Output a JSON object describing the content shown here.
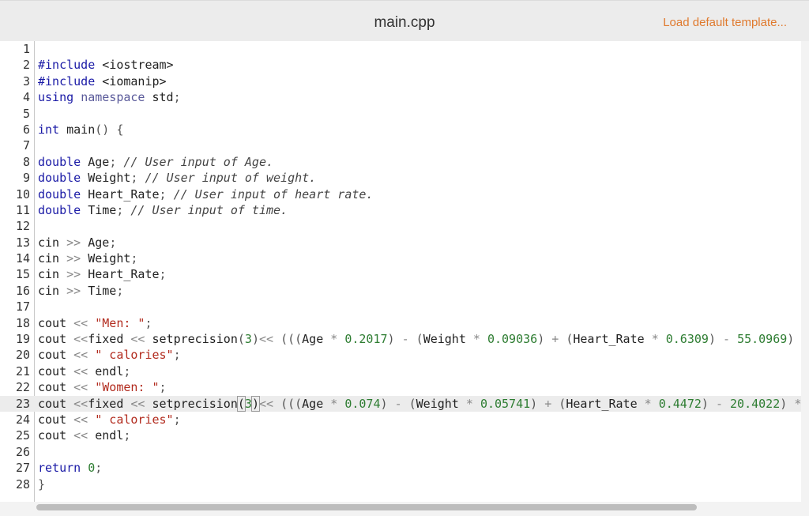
{
  "header": {
    "file_name": "main.cpp",
    "load_template_label": "Load default template..."
  },
  "editor": {
    "active_line": 23,
    "lines": [
      {
        "n": "1",
        "tokens": []
      },
      {
        "n": "2",
        "tokens": [
          [
            "pp",
            "#include "
          ],
          [
            "id",
            "<iostream>"
          ]
        ]
      },
      {
        "n": "3",
        "tokens": [
          [
            "pp",
            "#include "
          ],
          [
            "id",
            "<iomanip>"
          ]
        ]
      },
      {
        "n": "4",
        "tokens": [
          [
            "kw",
            "using "
          ],
          [
            "ns",
            "namespace "
          ],
          [
            "id",
            "std"
          ],
          [
            "pun",
            ";"
          ]
        ]
      },
      {
        "n": "5",
        "tokens": []
      },
      {
        "n": "6",
        "tokens": [
          [
            "kw",
            "int "
          ],
          [
            "id",
            "main"
          ],
          [
            "pun",
            "() {"
          ]
        ]
      },
      {
        "n": "7",
        "tokens": []
      },
      {
        "n": "8",
        "tokens": [
          [
            "kw",
            "double "
          ],
          [
            "id",
            "Age"
          ],
          [
            "pun",
            "; "
          ],
          [
            "cm",
            "// User input of Age."
          ]
        ]
      },
      {
        "n": "9",
        "tokens": [
          [
            "kw",
            "double "
          ],
          [
            "id",
            "Weight"
          ],
          [
            "pun",
            "; "
          ],
          [
            "cm",
            "// User input of weight."
          ]
        ]
      },
      {
        "n": "10",
        "tokens": [
          [
            "kw",
            "double "
          ],
          [
            "id",
            "Heart_Rate"
          ],
          [
            "pun",
            "; "
          ],
          [
            "cm",
            "// User input of heart rate."
          ]
        ]
      },
      {
        "n": "11",
        "tokens": [
          [
            "kw",
            "double "
          ],
          [
            "id",
            "Time"
          ],
          [
            "pun",
            "; "
          ],
          [
            "cm",
            "// User input of time."
          ]
        ]
      },
      {
        "n": "12",
        "tokens": []
      },
      {
        "n": "13",
        "tokens": [
          [
            "id",
            "cin "
          ],
          [
            "op",
            ">> "
          ],
          [
            "id",
            "Age"
          ],
          [
            "pun",
            ";"
          ]
        ]
      },
      {
        "n": "14",
        "tokens": [
          [
            "id",
            "cin "
          ],
          [
            "op",
            ">> "
          ],
          [
            "id",
            "Weight"
          ],
          [
            "pun",
            ";"
          ]
        ]
      },
      {
        "n": "15",
        "tokens": [
          [
            "id",
            "cin "
          ],
          [
            "op",
            ">> "
          ],
          [
            "id",
            "Heart_Rate"
          ],
          [
            "pun",
            ";"
          ]
        ]
      },
      {
        "n": "16",
        "tokens": [
          [
            "id",
            "cin "
          ],
          [
            "op",
            ">> "
          ],
          [
            "id",
            "Time"
          ],
          [
            "pun",
            ";"
          ]
        ]
      },
      {
        "n": "17",
        "tokens": []
      },
      {
        "n": "18",
        "tokens": [
          [
            "id",
            "cout "
          ],
          [
            "op",
            "<< "
          ],
          [
            "str",
            "\"Men: \""
          ],
          [
            "pun",
            ";"
          ]
        ]
      },
      {
        "n": "19",
        "tokens": [
          [
            "id",
            "cout "
          ],
          [
            "op",
            "<<"
          ],
          [
            "id",
            "fixed "
          ],
          [
            "op",
            "<< "
          ],
          [
            "id",
            "setprecision"
          ],
          [
            "pun",
            "("
          ],
          [
            "num",
            "3"
          ],
          [
            "pun",
            ")"
          ],
          [
            "op",
            "<< "
          ],
          [
            "pun",
            "((("
          ],
          [
            "id",
            "Age "
          ],
          [
            "op",
            "* "
          ],
          [
            "num",
            "0.2017"
          ],
          [
            "pun",
            ") "
          ],
          [
            "op",
            "- "
          ],
          [
            "pun",
            "("
          ],
          [
            "id",
            "Weight "
          ],
          [
            "op",
            "* "
          ],
          [
            "num",
            "0.09036"
          ],
          [
            "pun",
            ") "
          ],
          [
            "op",
            "+ "
          ],
          [
            "pun",
            "("
          ],
          [
            "id",
            "Heart_Rate "
          ],
          [
            "op",
            "* "
          ],
          [
            "num",
            "0.6309"
          ],
          [
            "pun",
            ") "
          ],
          [
            "op",
            "- "
          ],
          [
            "num",
            "55.0969"
          ],
          [
            "pun",
            ")"
          ]
        ]
      },
      {
        "n": "20",
        "tokens": [
          [
            "id",
            "cout "
          ],
          [
            "op",
            "<< "
          ],
          [
            "str",
            "\" calories\""
          ],
          [
            "pun",
            ";"
          ]
        ]
      },
      {
        "n": "21",
        "tokens": [
          [
            "id",
            "cout "
          ],
          [
            "op",
            "<< "
          ],
          [
            "id",
            "endl"
          ],
          [
            "pun",
            ";"
          ]
        ]
      },
      {
        "n": "22",
        "tokens": [
          [
            "id",
            "cout "
          ],
          [
            "op",
            "<< "
          ],
          [
            "str",
            "\"Women: \""
          ],
          [
            "pun",
            ";"
          ]
        ]
      },
      {
        "n": "23",
        "tokens": [
          [
            "id",
            "cout "
          ],
          [
            "op",
            "<<"
          ],
          [
            "id",
            "fixed "
          ],
          [
            "op",
            "<< "
          ],
          [
            "id",
            "setprecision"
          ],
          [
            "brk",
            "("
          ],
          [
            "num",
            "3"
          ],
          [
            "brk",
            ")"
          ],
          [
            "op",
            "<< "
          ],
          [
            "pun",
            "((("
          ],
          [
            "id",
            "Age "
          ],
          [
            "op",
            "* "
          ],
          [
            "num",
            "0.074"
          ],
          [
            "pun",
            ") "
          ],
          [
            "op",
            "- "
          ],
          [
            "pun",
            "("
          ],
          [
            "id",
            "Weight "
          ],
          [
            "op",
            "* "
          ],
          [
            "num",
            "0.05741"
          ],
          [
            "pun",
            ") "
          ],
          [
            "op",
            "+ "
          ],
          [
            "pun",
            "("
          ],
          [
            "id",
            "Heart_Rate "
          ],
          [
            "op",
            "* "
          ],
          [
            "num",
            "0.4472"
          ],
          [
            "pun",
            ") "
          ],
          [
            "op",
            "- "
          ],
          [
            "num",
            "20.4022"
          ],
          [
            "pun",
            ") "
          ],
          [
            "op",
            "*"
          ]
        ]
      },
      {
        "n": "24",
        "tokens": [
          [
            "id",
            "cout "
          ],
          [
            "op",
            "<< "
          ],
          [
            "str",
            "\" calories\""
          ],
          [
            "pun",
            ";"
          ]
        ]
      },
      {
        "n": "25",
        "tokens": [
          [
            "id",
            "cout "
          ],
          [
            "op",
            "<< "
          ],
          [
            "id",
            "endl"
          ],
          [
            "pun",
            ";"
          ]
        ]
      },
      {
        "n": "26",
        "tokens": []
      },
      {
        "n": "27",
        "tokens": [
          [
            "kw",
            "return "
          ],
          [
            "num",
            "0"
          ],
          [
            "pun",
            ";"
          ]
        ]
      },
      {
        "n": "28",
        "tokens": [
          [
            "pun",
            "}"
          ]
        ]
      }
    ]
  },
  "colors": {
    "link": "#e07a2e",
    "keyword": "#1a1aa6",
    "string": "#b22b1e",
    "number": "#2e7d32",
    "comment": "#444444"
  }
}
